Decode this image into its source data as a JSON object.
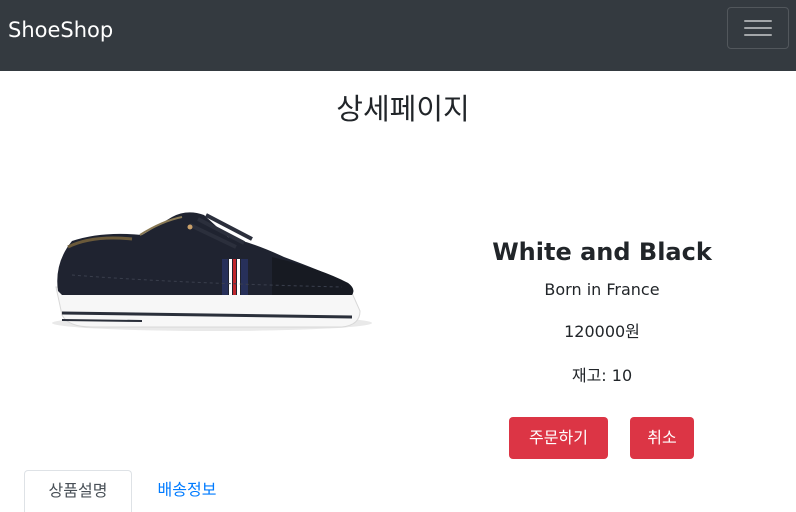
{
  "navbar": {
    "brand": "ShoeShop",
    "toggler_icon": "hamburger-icon"
  },
  "page": {
    "title": "상세페이지"
  },
  "product": {
    "name": "White and Black",
    "origin": "Born in France",
    "price": "120000원",
    "stock": "재고: 10",
    "image_description": "black canvas sneaker with white sole and red-white-blue side stripe"
  },
  "actions": {
    "order_label": "주문하기",
    "cancel_label": "취소"
  },
  "tabs": [
    {
      "label": "상품설명",
      "active": true
    },
    {
      "label": "배송정보",
      "active": false
    }
  ],
  "colors": {
    "navbar_bg": "#343a40",
    "danger": "#dc3545",
    "link": "#007bff"
  }
}
